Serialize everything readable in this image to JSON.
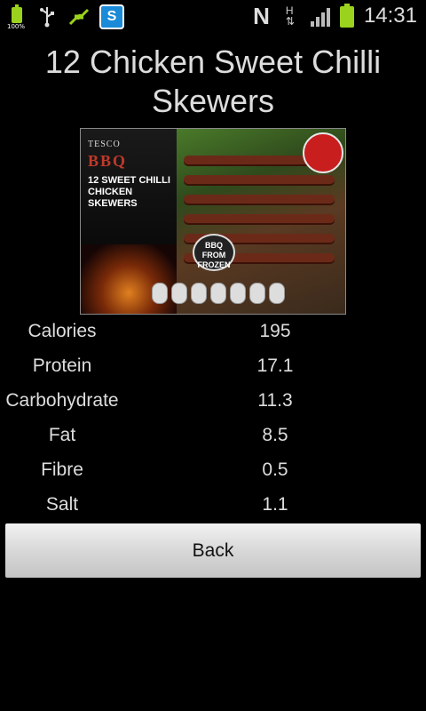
{
  "status_bar": {
    "battery_small_label": "100%",
    "clock": "14:31",
    "network_letter": "N",
    "data_type": "H",
    "icons": [
      "battery-icon",
      "usb-icon",
      "sync-icon",
      "skype-icon",
      "nfc-icon",
      "hspa-icon",
      "signal-icon",
      "battery-icon"
    ],
    "skype_letter": "S"
  },
  "title": "12 Chicken Sweet Chilli Skewers",
  "product_image": {
    "brand": "TESCO",
    "range": "BBQ",
    "name": "12 SWEET CHILLI CHICKEN SKEWERS",
    "badge": "BBQ FROM FROZEN"
  },
  "nutrition": [
    {
      "label": "Calories",
      "value": "195"
    },
    {
      "label": "Protein",
      "value": "17.1"
    },
    {
      "label": "Carbohydrate",
      "value": "11.3"
    },
    {
      "label": "Fat",
      "value": "8.5"
    },
    {
      "label": "Fibre",
      "value": "0.5"
    },
    {
      "label": "Salt",
      "value": "1.1"
    }
  ],
  "back_button_label": "Back",
  "colors": {
    "background": "#000000",
    "text": "#dddddd",
    "battery": "#9ad21e"
  }
}
